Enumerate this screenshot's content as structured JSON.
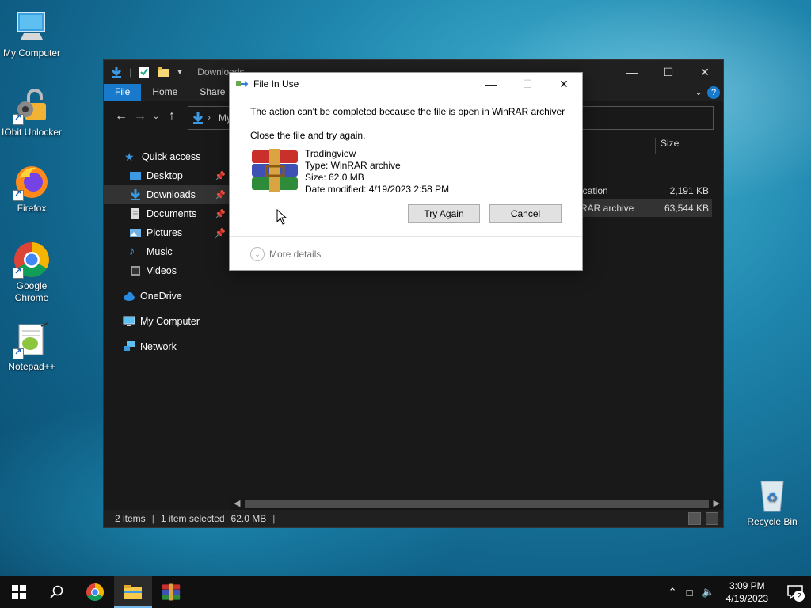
{
  "desktop": {
    "icons": [
      {
        "label": "My Computer"
      },
      {
        "label": "IObit Unlocker"
      },
      {
        "label": "Firefox"
      },
      {
        "label": "Google Chrome"
      },
      {
        "label": "Notepad++"
      },
      {
        "label": "Recycle Bin"
      }
    ]
  },
  "explorer": {
    "title": "Downloads",
    "ribbon_tabs": [
      "File",
      "Home",
      "Share"
    ],
    "address_fragment": "My",
    "sidebar": [
      {
        "label": "Quick access"
      },
      {
        "label": "Desktop"
      },
      {
        "label": "Downloads"
      },
      {
        "label": "Documents"
      },
      {
        "label": "Pictures"
      },
      {
        "label": "Music"
      },
      {
        "label": "Videos"
      },
      {
        "label": "OneDrive"
      },
      {
        "label": "My Computer"
      },
      {
        "label": "Network"
      }
    ],
    "column_size": "Size",
    "rows": [
      {
        "type": "ication",
        "size": "2,191 KB"
      },
      {
        "type": "RAR archive",
        "size": "63,544 KB"
      }
    ],
    "status": {
      "items": "2 items",
      "selected": "1 item selected",
      "size": "62.0 MB"
    }
  },
  "dialog": {
    "title": "File In Use",
    "message": "The action can't be completed because the file is open in WinRAR archiver",
    "sub_message": "Close the file and try again.",
    "file_name": "Tradingview",
    "file_type": "Type: WinRAR archive",
    "file_size": "Size: 62.0 MB",
    "file_modified": "Date modified: 4/19/2023 2:58 PM",
    "try_again_label": "Try Again",
    "cancel_label": "Cancel",
    "more_details_label": "More details"
  },
  "taskbar": {
    "time": "3:09 PM",
    "date": "4/19/2023",
    "notification_count": "2"
  },
  "colors": {
    "accent": "#1979ca",
    "explorer_bg": "#191919"
  }
}
